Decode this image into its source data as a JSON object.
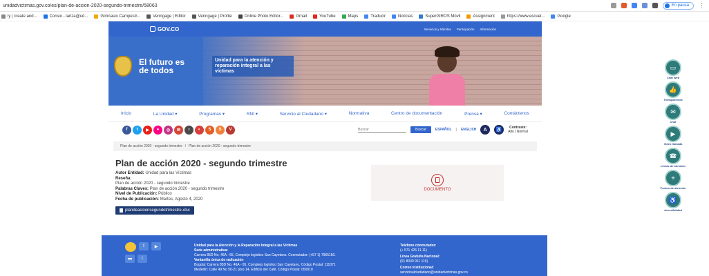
{
  "browser": {
    "url": "unidadvictimas.gov.co/es/plan-de-accion-2020-segundo-trimestre/58063",
    "profile_label": "En pausa",
    "bookmarks": [
      {
        "label": "ly | create and...",
        "color": "#888888"
      },
      {
        "label": "Correo - lariza@ud...",
        "color": "#1a73e8"
      },
      {
        "label": "Gimnasio Campestr...",
        "color": "#f2a900"
      },
      {
        "label": "Venngage | Editor",
        "color": "#555555"
      },
      {
        "label": "Venngage | Profile",
        "color": "#555555"
      },
      {
        "label": "Online Photo Editor...",
        "color": "#444444"
      },
      {
        "label": "Gmail",
        "color": "#d93025"
      },
      {
        "label": "YouTube",
        "color": "#e62117"
      },
      {
        "label": "Maps",
        "color": "#34a853"
      },
      {
        "label": "Traducir",
        "color": "#4285f4"
      },
      {
        "label": "Noticias",
        "color": "#4285f4"
      },
      {
        "label": "SuperGIROS Móvil",
        "color": "#2e7bcf"
      },
      {
        "label": "Assignment",
        "color": "#f29900"
      },
      {
        "label": "https://www.escuel...",
        "color": "#999999"
      },
      {
        "label": "Google",
        "color": "#4285f4"
      }
    ]
  },
  "site": {
    "gov_logo": "GOV.CO",
    "gov_links": [
      "Servicios y trámites",
      "Participación",
      "Información"
    ],
    "banner": {
      "motto": "El futuro es de todos",
      "unit_name": "Unidad para la atención y reparación integral a las víctimas"
    },
    "nav": [
      "Inicio",
      "La Unidad ▾",
      "Programas ▾",
      "RNI ▾",
      "Servicio al Ciudadano ▾",
      "Normativa",
      "Centro de documentación",
      "Prensa ▾",
      "Contáctenos"
    ],
    "socials": [
      {
        "label": "f",
        "color": "#3b5998"
      },
      {
        "label": "t",
        "color": "#1da1f2"
      },
      {
        "label": "▶",
        "color": "#e62117"
      },
      {
        "label": "●",
        "color": "#ff0084"
      },
      {
        "label": "◎",
        "color": "#c13584"
      },
      {
        "label": "✉",
        "color": "#d44638"
      },
      {
        "label": "○",
        "color": "#4a4a4a"
      },
      {
        "label": "◐",
        "color": "#d7403a"
      },
      {
        "label": "S",
        "color": "#e35d24"
      },
      {
        "label": "S",
        "color": "#f1813a"
      },
      {
        "label": "V",
        "color": "#b93a32"
      }
    ],
    "search_placeholder": "Buscar",
    "search_button": "Buscar",
    "lang_es": "ESPAÑOL",
    "lang_en": "ENGLISH",
    "contrast_label": "Contraste:",
    "contrast_options": "Alto | Normal",
    "breadcrumb": [
      "Plan de acción 2020 - segundo trimestre",
      "/",
      "Plan de acción 2020 - segundo trimestre"
    ],
    "page_title": "Plan de acción 2020 - segundo trimestre",
    "meta": {
      "autor_label": "Autor Entidad:",
      "autor_value": "Unidad para las Víctimas",
      "resena_label": "Reseña:",
      "resena_value": "Plan de acción 2020 - segundo trimestre",
      "claves_label": "Palabras Claves:",
      "claves_value": "Plan de acción 2020 - segundo trimestre",
      "nivel_label": "Nivel de Publicación:",
      "nivel_value": "Público",
      "fecha_label": "Fecha de publicación:",
      "fecha_value": "Martes, Agosto 4, 2020"
    },
    "file_button": "plandeaccionsegundotrimestre.xlsx",
    "document_label": "DOCUMENTO",
    "footer": {
      "org": "Unidad para la Atención y la Reparación Integral a las Víctimas",
      "sede_label": "Sede administrativa:",
      "sede_value": "Carrera 85D No. 46A - 65, Complejo logístico San Cayetano. Conmutador: (+57 1) 7965150.",
      "ventanilla_label": "Ventanilla única de radicación",
      "ventanilla_value": "Bogotá: Carrera 85D No. 46A - 65, Complejo logístico San Cayetano, Código Postal: 111071",
      "ventanilla_value2": "Medellín: Calle 49 No 50-21 piso 14, Edificio del Café. Código Postal: 050010",
      "tel_label": "Teléfono conmutador:",
      "tel_value": "(+ 571 426 11 11)",
      "linea_label": "Línea Gratuita Nacional:",
      "linea_value": "(01 8000 911 119)",
      "correo_label": "Correo institucional:",
      "correo_value": "servicioalciudadano@unidadvictimas.gov.co"
    }
  },
  "right_sidebar": [
    {
      "label": "Chat Web",
      "icon": "chat-icon"
    },
    {
      "label": "Transparencia",
      "icon": "thumbs-up-icon"
    },
    {
      "label": "Chat",
      "icon": "message-icon"
    },
    {
      "label": "Video llamada",
      "icon": "video-icon"
    },
    {
      "label": "Líneas de atención",
      "icon": "phone-icon"
    },
    {
      "label": "Puntos de atención",
      "icon": "location-icon"
    },
    {
      "label": "Accesibilidad",
      "icon": "wheelchair-icon"
    }
  ]
}
